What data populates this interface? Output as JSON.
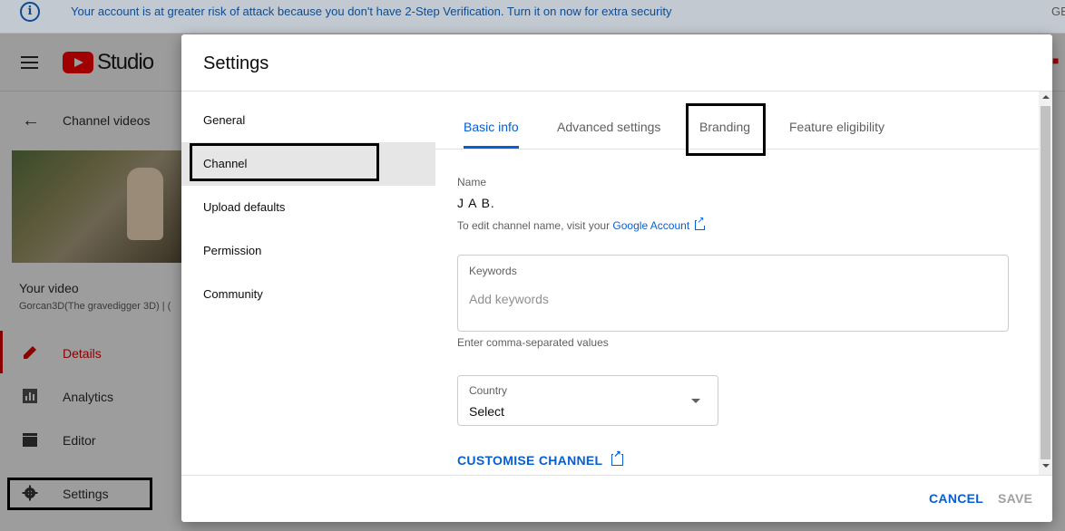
{
  "banner": {
    "icon": "info-icon",
    "icon_glyph": "i",
    "text": "Your account is at greater risk of attack because you don't have 2-Step Verification. Turn it on now for extra security",
    "right_text": "GE"
  },
  "topbar": {
    "logo_icon": "youtube-logo-icon",
    "studio_label": "Studio"
  },
  "sidebar": {
    "back_label": "Channel videos",
    "your_video_label": "Your video",
    "video_title": "Gorcan3D(The gravedigger 3D) | (",
    "items": [
      {
        "label": "Details",
        "icon": "pencil-icon",
        "active": true
      },
      {
        "label": "Analytics",
        "icon": "analytics-icon"
      },
      {
        "label": "Editor",
        "icon": "clapperboard-icon"
      },
      {
        "label": "Settings",
        "icon": "gear-icon"
      }
    ]
  },
  "modal": {
    "title": "Settings",
    "nav": [
      {
        "label": "General"
      },
      {
        "label": "Channel",
        "active": true
      },
      {
        "label": "Upload defaults"
      },
      {
        "label": "Permission"
      },
      {
        "label": "Community"
      }
    ],
    "tabs": [
      {
        "label": "Basic info",
        "active": true
      },
      {
        "label": "Advanced settings"
      },
      {
        "label": "Branding"
      },
      {
        "label": "Feature eligibility"
      }
    ],
    "basic_info": {
      "name_label": "Name",
      "name_value": "J A B.",
      "edit_hint_prefix": "To edit channel name, visit your ",
      "edit_hint_link": "Google Account",
      "keywords_label": "Keywords",
      "keywords_placeholder": "Add keywords",
      "keywords_value": "",
      "keywords_hint": "Enter comma-separated values",
      "country_label": "Country",
      "country_value": "Select",
      "customise_label": "CUSTOMISE CHANNEL"
    },
    "footer": {
      "cancel_label": "CANCEL",
      "save_label": "SAVE"
    }
  },
  "colors": {
    "accent_blue": "#065fd4",
    "brand_red": "#cc0000",
    "banner_text": "#0f4b91",
    "disabled_text": "#a0a0a0"
  }
}
